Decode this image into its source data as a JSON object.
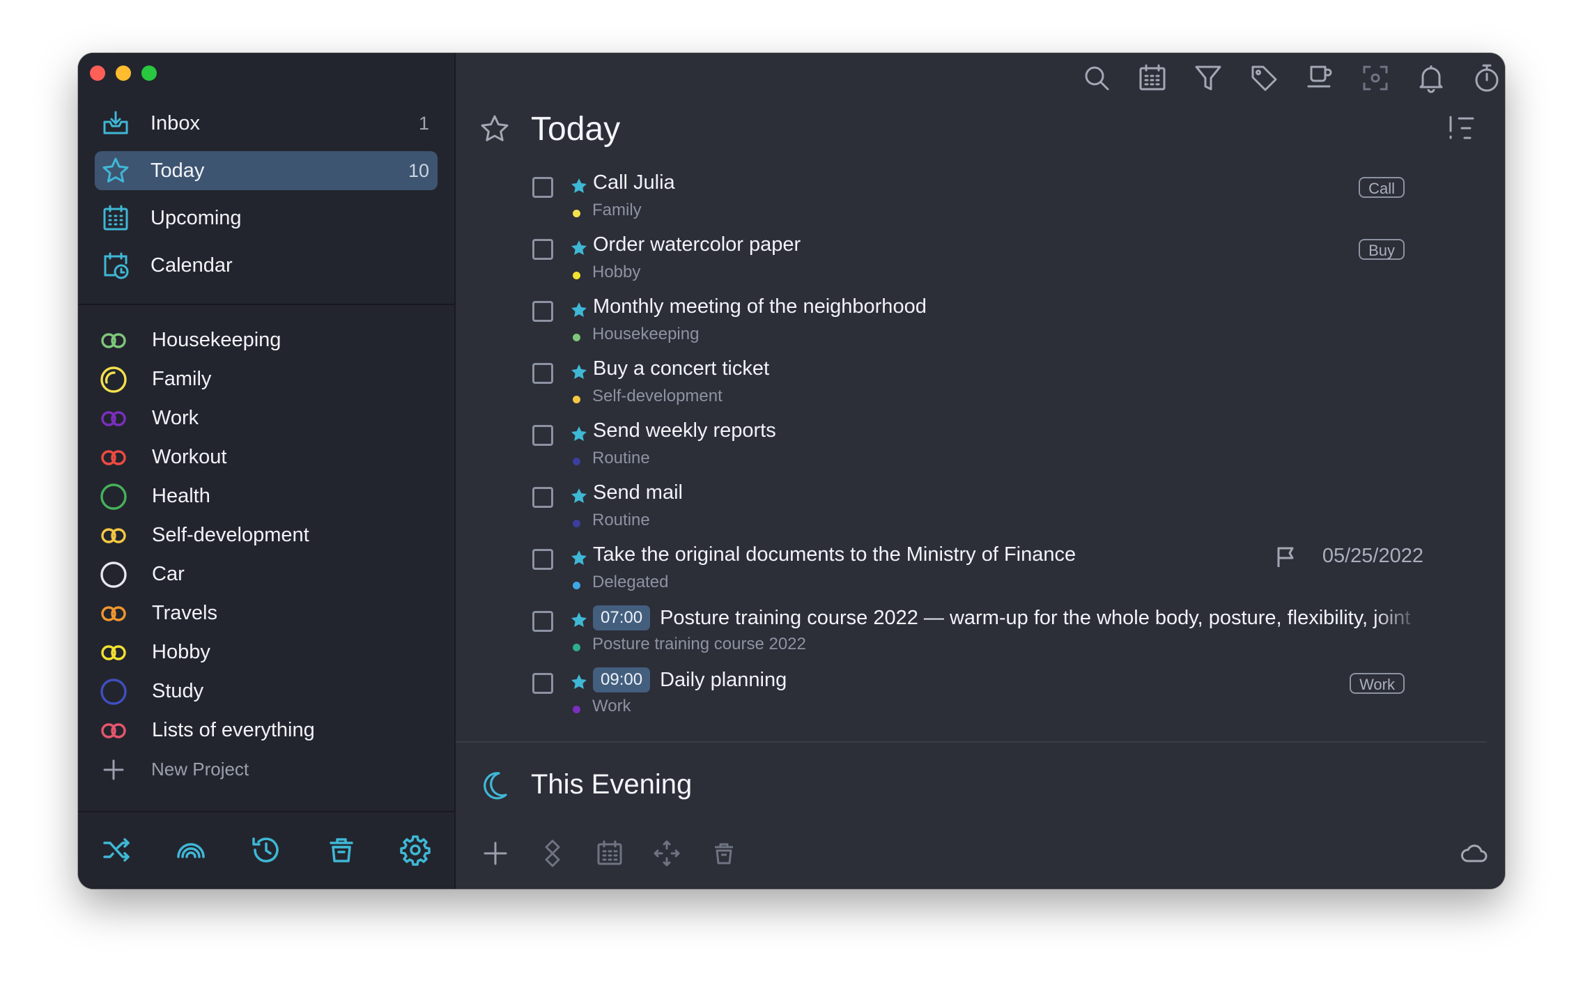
{
  "colors": {
    "accent": "#3fb8d6",
    "sidebar_bg": "#23252e",
    "main_bg": "#2c2e38",
    "active_item_bg": "#3e5571"
  },
  "sidebar": {
    "nav": [
      {
        "label": "Inbox",
        "count": "1",
        "icon": "inbox-icon"
      },
      {
        "label": "Today",
        "count": "10",
        "icon": "star-icon"
      },
      {
        "label": "Upcoming",
        "count": "",
        "icon": "calendar-grid-icon"
      },
      {
        "label": "Calendar",
        "count": "",
        "icon": "calendar-clock-icon"
      }
    ],
    "projects": [
      {
        "label": "Housekeeping",
        "color": "#7ec77a",
        "shape": "linked-rings"
      },
      {
        "label": "Family",
        "color": "#f4e04d",
        "shape": "partial-ring"
      },
      {
        "label": "Work",
        "color": "#7b2fbf",
        "shape": "linked-rings"
      },
      {
        "label": "Workout",
        "color": "#ef4b42",
        "shape": "linked-rings"
      },
      {
        "label": "Health",
        "color": "#45b35a",
        "shape": "circle"
      },
      {
        "label": "Self-development",
        "color": "#f5c842",
        "shape": "linked-rings"
      },
      {
        "label": "Car",
        "color": "#e6e7ec",
        "shape": "circle"
      },
      {
        "label": "Travels",
        "color": "#f2962e",
        "shape": "linked-rings"
      },
      {
        "label": "Hobby",
        "color": "#f2e230",
        "shape": "linked-rings"
      },
      {
        "label": "Study",
        "color": "#3f4fc2",
        "shape": "circle"
      },
      {
        "label": "Lists of everything",
        "color": "#e5566e",
        "shape": "linked-rings"
      }
    ],
    "new_project_label": "New Project",
    "bottom_icons": [
      "shuffle-icon",
      "rainbow-icon",
      "history-icon",
      "trash-icon",
      "settings-icon"
    ]
  },
  "toolbar_icons": [
    "search-icon",
    "calendar-icon",
    "filter-icon",
    "tag-icon",
    "coffee-icon",
    "focus-icon",
    "bell-icon",
    "timer-icon",
    "copy-icon"
  ],
  "today": {
    "title": "Today",
    "tasks": [
      {
        "title": "Call Julia",
        "project": "Family",
        "dot_color": "#f4e04d",
        "tag": "Call"
      },
      {
        "title": "Order watercolor paper",
        "project": "Hobby",
        "dot_color": "#f2e230",
        "tag": "Buy"
      },
      {
        "title": "Monthly meeting of the neighborhood",
        "project": "Housekeeping",
        "dot_color": "#7ec77a"
      },
      {
        "title": "Buy a concert ticket",
        "project": "Self-development",
        "dot_color": "#f5c842"
      },
      {
        "title": "Send weekly reports",
        "project": "Routine",
        "dot_color": "#3a3f9e"
      },
      {
        "title": "Send mail",
        "project": "Routine",
        "dot_color": "#3a3f9e"
      },
      {
        "title": "Take the original documents to the Ministry of Finance",
        "project": "Delegated",
        "dot_color": "#3fa7e6",
        "due": "05/25/2022"
      },
      {
        "time": "07:00",
        "title": "Posture training course 2022 — warm-up for the whole body, posture, flexibility, joint",
        "project": "Posture training course 2022",
        "dot_color": "#2fae8a"
      },
      {
        "time": "09:00",
        "title": "Daily planning",
        "project": "Work",
        "dot_color": "#7b2fbf",
        "tag": "Work"
      }
    ]
  },
  "evening": {
    "title": "This Evening"
  },
  "main_bottom_icons": [
    "add-icon",
    "move-icon",
    "calendar-icon",
    "arrows-icon",
    "trash-icon",
    "cloud-icon"
  ]
}
